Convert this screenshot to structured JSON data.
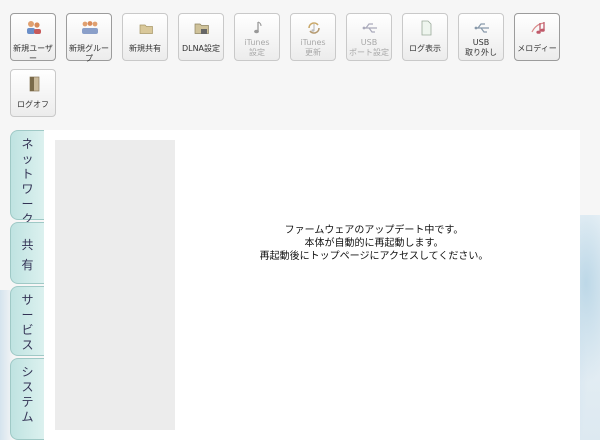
{
  "toolbar": {
    "buttons": [
      {
        "label": "新規ユーザー",
        "icon": "users-icon",
        "enabled": true
      },
      {
        "label": "新規グループ",
        "icon": "group-icon",
        "enabled": true
      },
      {
        "label": "新規共有",
        "icon": "folder-icon",
        "enabled": true
      },
      {
        "label": "DLNA設定",
        "icon": "dlna-folder-icon",
        "enabled": true
      },
      {
        "label": "iTunes\n設定",
        "icon": "music-note-icon",
        "enabled": false
      },
      {
        "label": "iTunes\n更新",
        "icon": "refresh-icon",
        "enabled": false
      },
      {
        "label": "USB\nポート設定",
        "icon": "usb-icon",
        "enabled": false
      },
      {
        "label": "ログ表示",
        "icon": "document-icon",
        "enabled": true
      },
      {
        "label": "USB\n取り外し",
        "icon": "usb-eject-icon",
        "enabled": true
      },
      {
        "label": "メロディー",
        "icon": "melody-icon",
        "enabled": true
      },
      {
        "label": "ログオフ",
        "icon": "logoff-door-icon",
        "enabled": true
      }
    ]
  },
  "tabs": [
    {
      "label": "ネットワーク"
    },
    {
      "label": "共有"
    },
    {
      "label": "サービス"
    },
    {
      "label": "システム"
    }
  ],
  "message": {
    "line1": "ファームウェアのアップデート中です。",
    "line2": "本体が自動的に再起動します。",
    "line3": "再起動後にトップページにアクセスしてください。"
  }
}
